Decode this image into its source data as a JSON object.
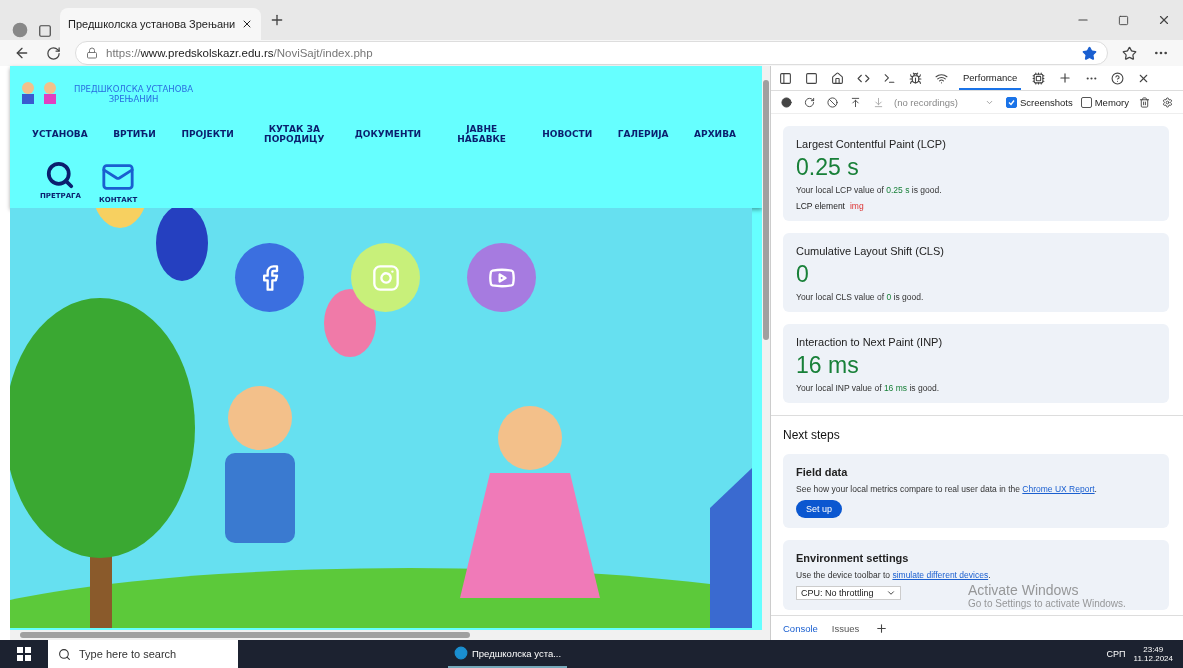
{
  "browser": {
    "tabs": [
      {
        "title": "Предшколска установа Зрењани",
        "selected": true
      }
    ],
    "url": {
      "scheme": "https://",
      "host": "www.predskolskazr.edu.rs",
      "path": "/NoviSajt/index.php"
    }
  },
  "site": {
    "logo_lines": [
      "ПРЕДШКОЛСКА УСТАНОВА",
      "ЗРЕЊАНИН"
    ],
    "nav": [
      "УСТАНОВА",
      "ВРТИЋИ",
      "ПРОЈЕКТИ",
      "КУТАК ЗА ПОРОДИЦУ",
      "ДОКУМЕНТИ",
      "ЈАВНЕ НАБАВКЕ",
      "НОВОСТИ",
      "ГАЛЕРИЈА",
      "АРХИВА"
    ],
    "quick_links": [
      {
        "kind": "search",
        "label": "ПРЕТРАГА"
      },
      {
        "kind": "contact",
        "label": "КОНТАКТ"
      }
    ],
    "social": [
      {
        "kind": "facebook",
        "color": "#3b6fe0"
      },
      {
        "kind": "instagram",
        "color": "#c8f07a"
      },
      {
        "kind": "youtube",
        "color": "#a67be0"
      }
    ]
  },
  "devtools": {
    "tabs": [
      {
        "label": "Performance",
        "selected": true
      }
    ],
    "recordings": {
      "placeholder": "(no recordings)"
    },
    "options": [
      {
        "label": "Screenshots",
        "checked": true
      },
      {
        "label": "Memory",
        "checked": false
      }
    ],
    "metrics": [
      {
        "title": "Largest Contentful Paint (LCP)",
        "value": "0.25 s",
        "note": "Your local LCP value of **0.25 s** is good.",
        "element_label": "LCP element",
        "element_value": "img"
      },
      {
        "title": "Cumulative Layout Shift (CLS)",
        "value": "0",
        "note": "Your local CLS value of **0** is good."
      },
      {
        "title": "Interaction to Next Paint (INP)",
        "value": "16 ms",
        "note": "Your local INP value of **16 ms** is good."
      }
    ],
    "next_steps": {
      "heading": "Next steps",
      "field_data": {
        "title": "Field data",
        "text": "See how your local metrics compare to real user data in the",
        "link": "Chrome UX Report",
        "after": ".",
        "button": "Set up"
      },
      "environment": {
        "title": "Environment settings",
        "text": "Use the device toolbar to",
        "link": "simulate different devices",
        "after": ".",
        "select": "CPU: No throttling"
      }
    },
    "drawer_tabs": [
      {
        "label": "Console",
        "selected": true
      },
      {
        "label": "Issues",
        "selected": false
      }
    ]
  },
  "activation": {
    "title": "Activate Windows",
    "text": "Go to Settings to activate Windows."
  },
  "taskbar": {
    "search_placeholder": "Type here to search",
    "app": "Предшколска уста...",
    "language": "СРП",
    "time": "23:49",
    "date": "11.12.2024"
  }
}
